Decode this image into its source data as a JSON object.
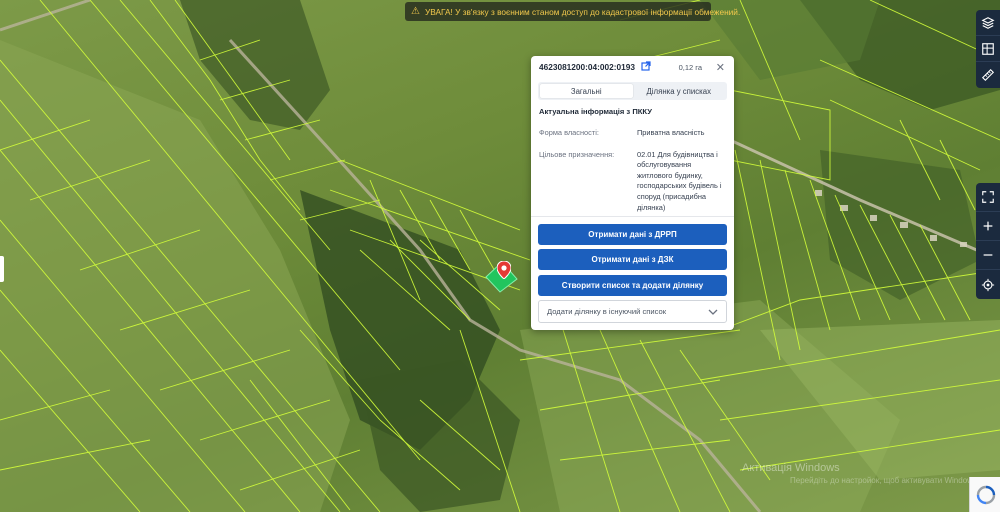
{
  "warning": {
    "icon": "warning-triangle-icon",
    "text": "УВАГА! У зв'язку з воєнним станом доступ до кадастрової інформації обмежений."
  },
  "popup": {
    "cadastral_number": "4623081200:04:002:0193",
    "area": "0,12 га",
    "tabs": [
      "Загальні",
      "Ділянка у списках"
    ],
    "active_tab": "Загальні",
    "section_title": "Актуальна інформація з ПККУ",
    "ownership_label": "Форма власності:",
    "ownership_value": "Приватна власність",
    "purpose_label": "Цільове призначення:",
    "purpose_value": "02.01 Для будівництва і обслуговування житлового будинку, господарських будівель і споруд (присадибна ділянка)",
    "button_drrp": "Отримати дані з ДРРП",
    "button_dzk": "Отримати дані з ДЗК",
    "button_create_list": "Створити список та додати ділянку",
    "add_existing_list": "Додати ділянку в існуючий список"
  },
  "colors": {
    "accent": "#1c5fbd",
    "parcel_lines": "#d4ff3a",
    "selected_parcel": "#22c55e",
    "marker": "#e53935",
    "toolbar": "#1b2a3e"
  },
  "watermark": {
    "line1": "Активація Windows",
    "line2": "Перейдіть до настройок, щоб активувати Windows."
  }
}
